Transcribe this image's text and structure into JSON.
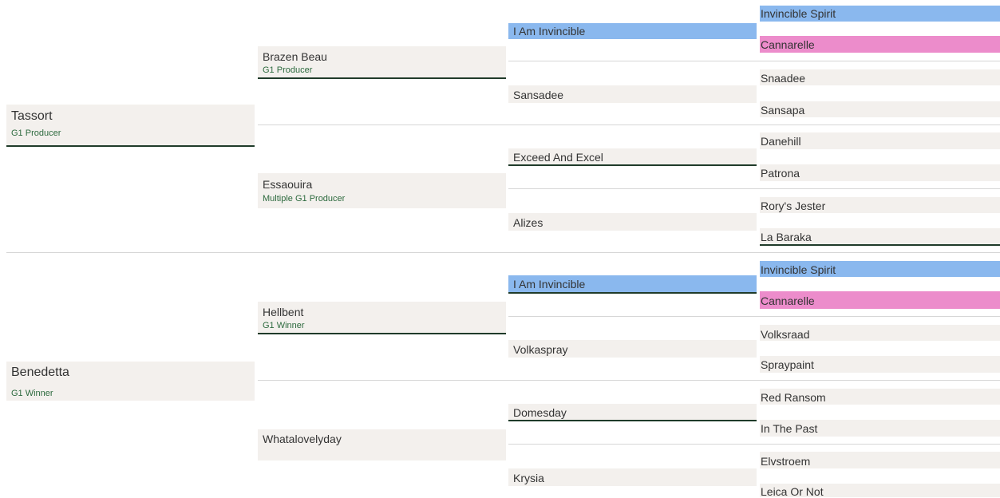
{
  "colors": {
    "box_bg": "#f3f0ed",
    "highlight_blue": "#8ab8ee",
    "highlight_pink": "#ec8ccb",
    "status_green": "#2d6a3e",
    "underline_dark": "#1f3b2a"
  },
  "gen1": [
    {
      "name": "Tassort",
      "status": "G1 Producer"
    },
    {
      "name": "Benedetta",
      "status": "G1 Winner"
    }
  ],
  "gen2": [
    {
      "name": "Brazen Beau",
      "status": "G1 Producer"
    },
    {
      "name": "Essaouira",
      "status": "Multiple G1 Producer"
    },
    {
      "name": "Hellbent",
      "status": "G1 Winner"
    },
    {
      "name": "Whatalovelyday",
      "status": ""
    }
  ],
  "gen3": [
    {
      "name": "I Am Invincible"
    },
    {
      "name": "Sansadee"
    },
    {
      "name": "Exceed And Excel"
    },
    {
      "name": "Alizes"
    },
    {
      "name": "I Am Invincible"
    },
    {
      "name": "Volkaspray"
    },
    {
      "name": "Domesday"
    },
    {
      "name": "Krysia"
    }
  ],
  "gen4": [
    {
      "name": "Invincible Spirit"
    },
    {
      "name": "Cannarelle"
    },
    {
      "name": "Snaadee"
    },
    {
      "name": "Sansapa"
    },
    {
      "name": "Danehill"
    },
    {
      "name": "Patrona"
    },
    {
      "name": "Rory's Jester"
    },
    {
      "name": "La Baraka"
    },
    {
      "name": "Invincible Spirit"
    },
    {
      "name": "Cannarelle"
    },
    {
      "name": "Volksraad"
    },
    {
      "name": "Spraypaint"
    },
    {
      "name": "Red Ransom"
    },
    {
      "name": "In The Past"
    },
    {
      "name": "Elvstroem"
    },
    {
      "name": "Leica Or Not"
    }
  ]
}
